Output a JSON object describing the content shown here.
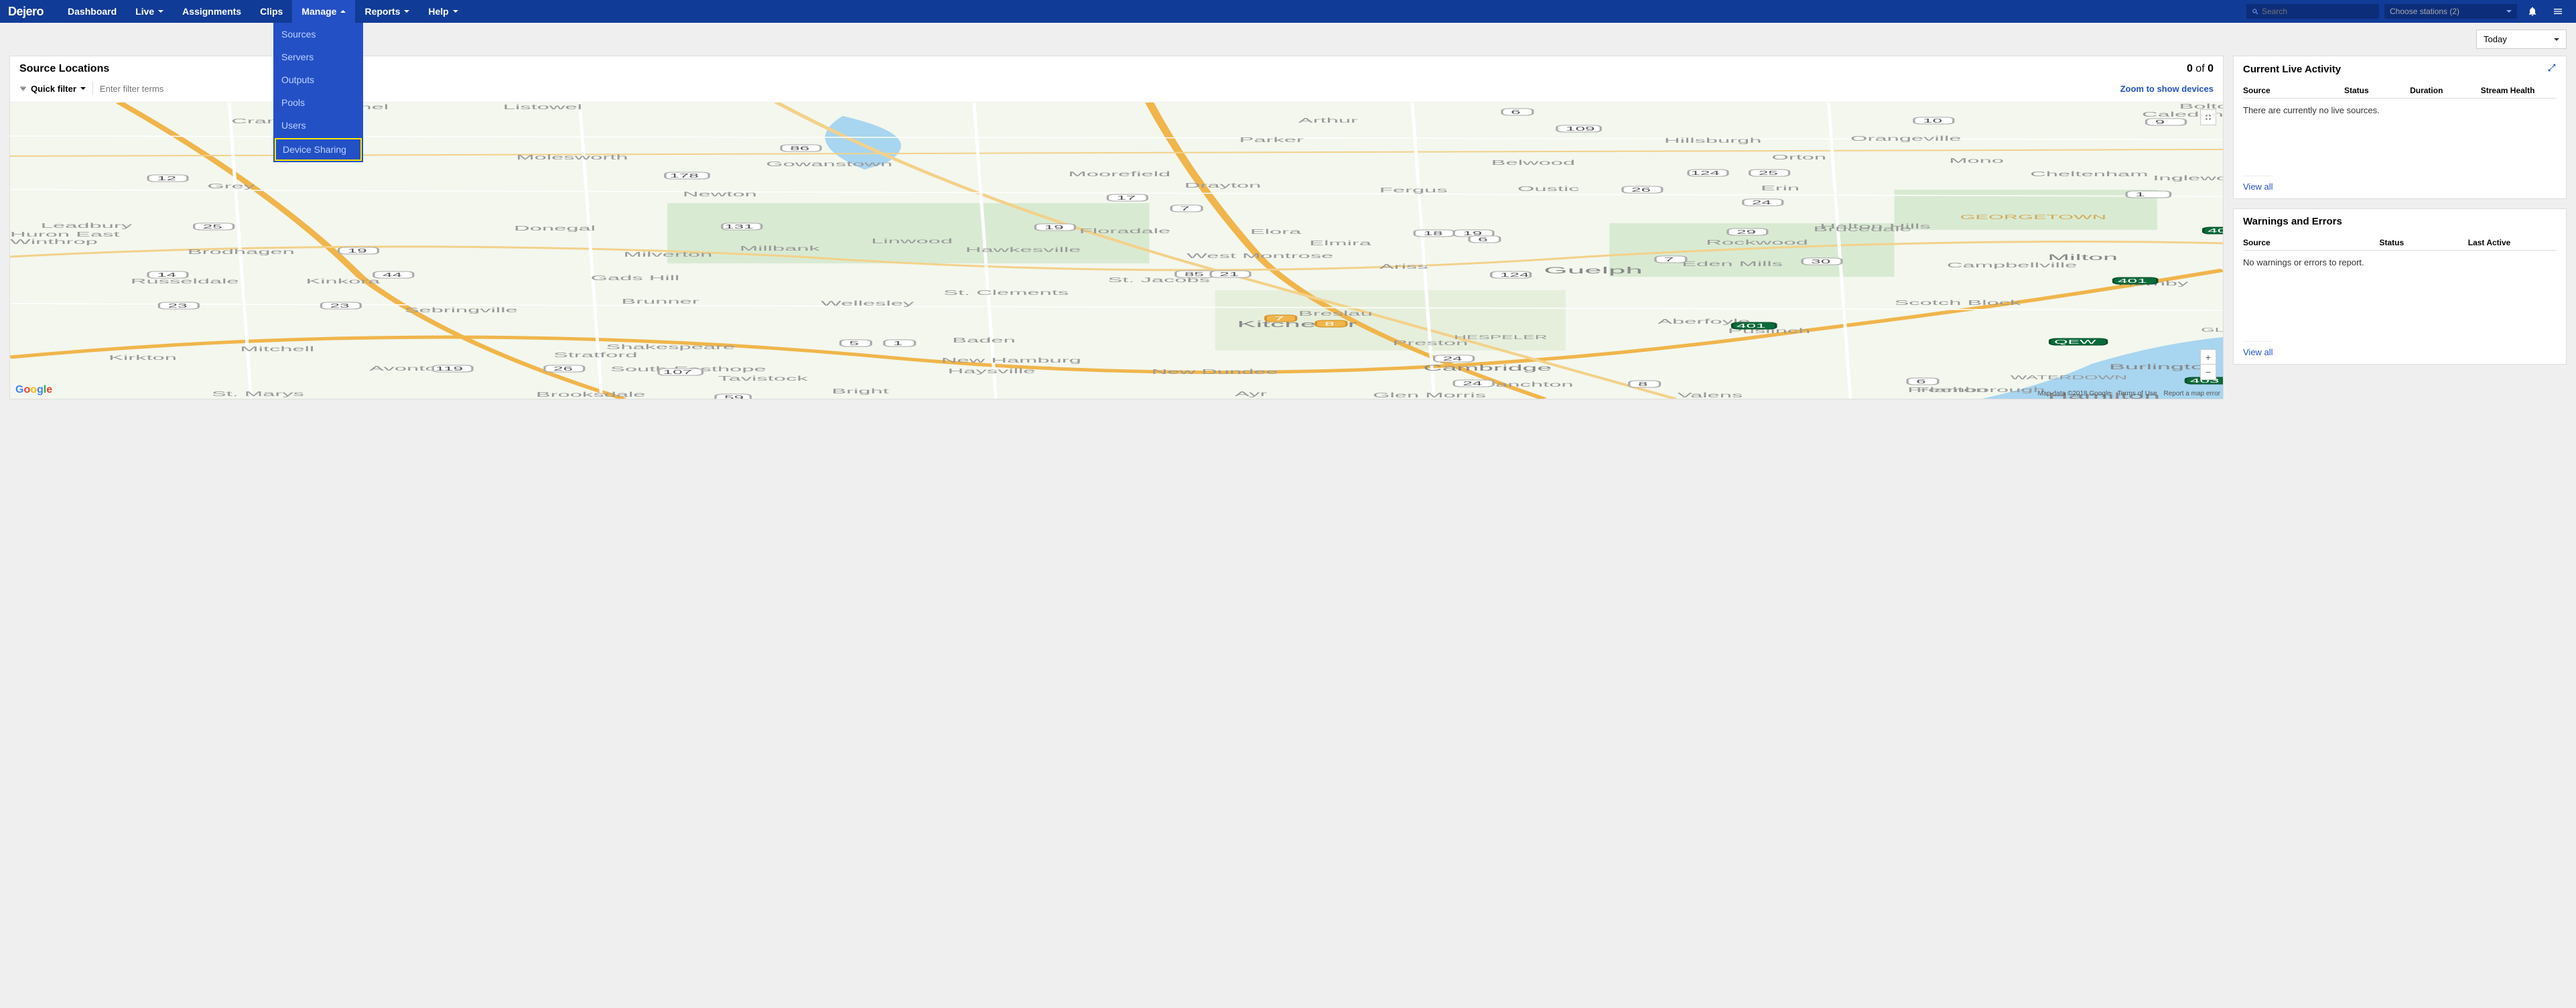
{
  "brand": "Dejero",
  "nav": {
    "dashboard": "Dashboard",
    "live": "Live",
    "assignments": "Assignments",
    "clips": "Clips",
    "manage": "Manage",
    "reports": "Reports",
    "help": "Help"
  },
  "manage_menu": {
    "sources": "Sources",
    "servers": "Servers",
    "outputs": "Outputs",
    "pools": "Pools",
    "users": "Users",
    "device_sharing": "Device Sharing"
  },
  "search_placeholder": "Search",
  "stations_label": "Choose stations (2)",
  "date_filter": "Today",
  "source_locations": {
    "title": "Source Locations",
    "count_current": "0",
    "count_sep": " of ",
    "count_total": "0",
    "quick_filter_label": "Quick filter",
    "filter_placeholder": "Enter filter terms",
    "zoom_link": "Zoom to show devices"
  },
  "map": {
    "attribution_data": "Map data ©2018 Google",
    "attribution_terms": "Terms of Use",
    "attribution_report": "Report a map error"
  },
  "live_activity": {
    "title": "Current Live Activity",
    "col_source": "Source",
    "col_status": "Status",
    "col_duration": "Duration",
    "col_health": "Stream Health",
    "empty": "There are currently no live sources.",
    "view_all": "View all"
  },
  "warnings": {
    "title": "Warnings and Errors",
    "col_source": "Source",
    "col_status": "Status",
    "col_lastactive": "Last Active",
    "empty": "No warnings or errors to report.",
    "view_all": "View all"
  }
}
